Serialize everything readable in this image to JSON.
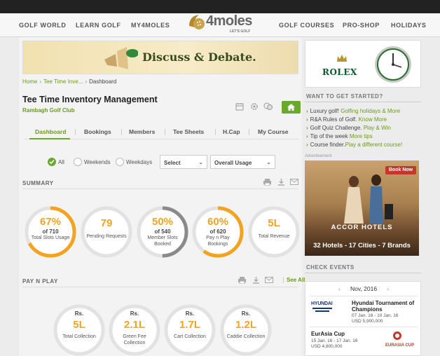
{
  "nav": {
    "items": [
      "GOLF WORLD",
      "LEARN GOLF",
      "MY4MOLES",
      "GOLF COURSES",
      "PRO-SHOP",
      "HOLIDAYS"
    ],
    "logo_text": "4moles",
    "logo_sub": "LET'S GOLF"
  },
  "banner": {
    "title": "Discuss & Debate."
  },
  "breadcrumb": {
    "home": "Home",
    "parent": "Tee Time Inve...",
    "current": "Dashboard"
  },
  "page": {
    "title": "Tee Time Inventory Management",
    "subtitle": "Rambagh Golf Club"
  },
  "tabs": [
    "Dashboard",
    "Bookings",
    "Members",
    "Tee Sheets",
    "H.Cap",
    "My Course"
  ],
  "filters": {
    "radios": [
      "All",
      "Weekends",
      "Weekdays"
    ],
    "selected_radio": "All",
    "select1": "Select",
    "select2": "Overall Usage"
  },
  "summary": {
    "heading": "SUMMARY",
    "cards": [
      {
        "big": "67%",
        "mid": "of 710",
        "label": "Total Slots Usage",
        "fraction": 0.67
      },
      {
        "big": "79",
        "mid": "",
        "label": "Pending Requests",
        "fraction": 0
      },
      {
        "big": "50%",
        "mid": "of 540",
        "label": "Member Slots Booked",
        "fraction": 0.5
      },
      {
        "big": "60%",
        "mid": "of 620",
        "label": "Pay n Play Bookings",
        "fraction": 0.6
      },
      {
        "big": "5L",
        "mid": "",
        "label": "Total Revenue",
        "fraction": 0
      }
    ]
  },
  "paynplay": {
    "heading": "PAY N PLAY",
    "see_all": "See All",
    "cards": [
      {
        "prefix": "Rs.",
        "big": "5L",
        "label": "Total Collection"
      },
      {
        "prefix": "Rs.",
        "big": "2.1L",
        "label": "Green Fee Collection"
      },
      {
        "prefix": "Rs.",
        "big": "1.7L",
        "label": "Cart Collection"
      },
      {
        "prefix": "Rs.",
        "big": "1.2L",
        "label": "Caddie Collection"
      }
    ]
  },
  "sidebar": {
    "rolex": "ROLEX",
    "get_started_heading": "WANT TO GET STARTED?",
    "get_started": [
      {
        "text": "Luxury golf! ",
        "link": "Golfing holidays & More"
      },
      {
        "text": "R&A Rules of Golf. ",
        "link": "Know More"
      },
      {
        "text": "Golf Quiz Challenge. ",
        "link": "Play & Win"
      },
      {
        "text": "Tip of the week ",
        "link": "More tips"
      },
      {
        "text": "Course finder.",
        "link": "Play a different course!"
      }
    ],
    "advertisement": "Advertisement",
    "accor": {
      "book_now": "Book Now",
      "name": "ACCOR HOTELS",
      "stats": "32 Hotels - 17 Cities - 7 Brands"
    },
    "events_heading": "CHECK EVENTS",
    "events_month": "Nov, 2016",
    "events": [
      {
        "logo": "HYUNDAI",
        "title": "Hyundai Tournament of Champions",
        "dates": "07 Jan. 16 - 10 Jan. 16",
        "prize": "USD 5,900,000"
      },
      {
        "logo": "EURASIA CUP",
        "title": "EurAsia Cup",
        "dates": "15 Jan. 16 - 17 Jan. 16",
        "prize": "USD 4,800,000"
      }
    ]
  },
  "colors": {
    "accent_green": "#6aa830",
    "ring_orange": "#f2a321",
    "ring_gray": "#8a8a8a"
  }
}
